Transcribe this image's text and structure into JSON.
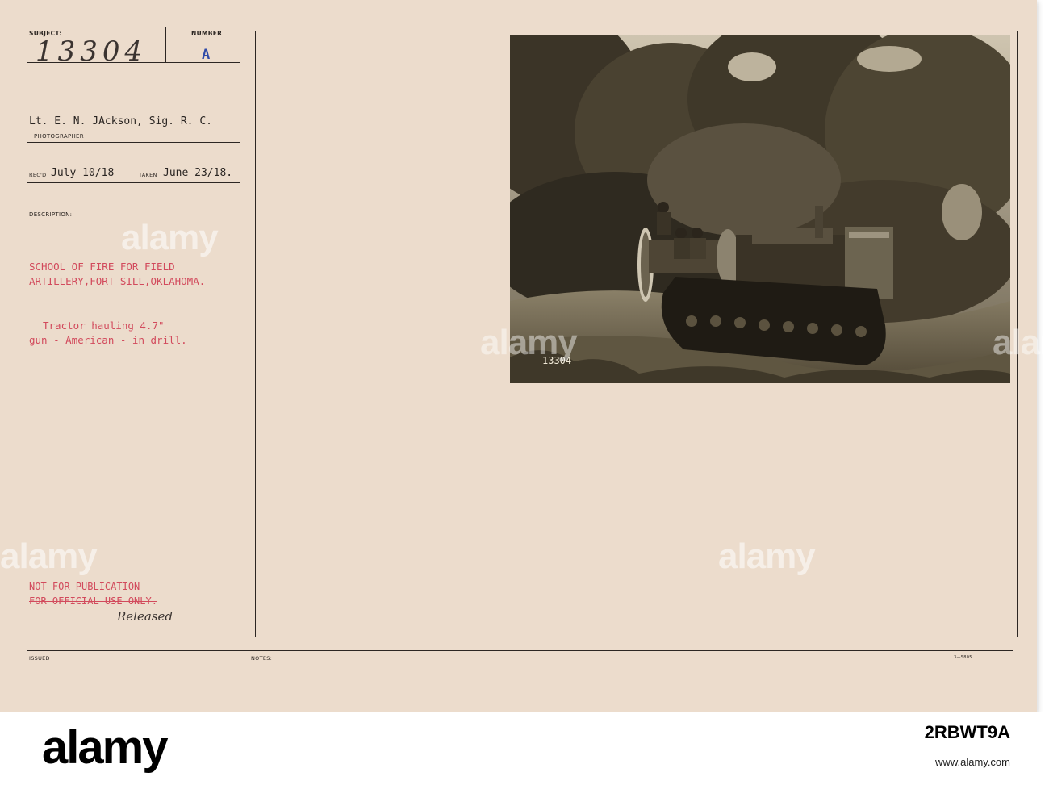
{
  "card": {
    "subject_label": "SUBJECT:",
    "subject_value": "13304",
    "number_label": "NUMBER",
    "number_value": "A",
    "photographer_value": "Lt. E. N. JAckson, Sig. R. C.",
    "photographer_label": "PHOTOGRAPHER",
    "recd_label": "REC'D",
    "recd_value": "July 10/18",
    "taken_label": "TAKEN",
    "taken_value": "June 23/18.",
    "description_label": "DESCRIPTION:",
    "description_line1": "SCHOOL OF FIRE FOR FIELD",
    "description_line2": "ARTILLERY,FORT SILL,OKLAHOMA.",
    "caption_line1": "Tractor hauling 4.7\"",
    "caption_line2": "gun - American - in drill.",
    "restriction_line1": "NOT FOR PUBLICATION",
    "restriction_line2": "FOR OFFICIAL USE ONLY.",
    "released_note": "Released",
    "issued_label": "ISSUED",
    "notes_label": "NOTES:",
    "form_code": "3—5805",
    "photo_stamp": "13304"
  },
  "watermarks": [
    "alamy",
    "alamy",
    "alamy",
    "alamy",
    "alamy"
  ],
  "footer": {
    "logo": "alamy",
    "image_id_label": "Image ID: 2RBWT9A",
    "code": "2RBWT9A",
    "website": "www.alamy.com"
  }
}
